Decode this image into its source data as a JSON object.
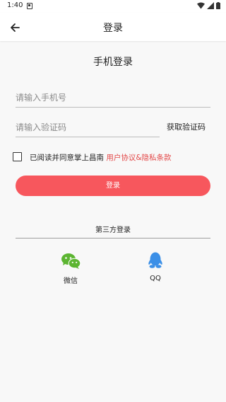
{
  "status_bar": {
    "time": "1:40"
  },
  "app_bar": {
    "title": "登录"
  },
  "page": {
    "heading": "手机登录"
  },
  "form": {
    "phone_placeholder": "请输入手机号",
    "code_placeholder": "请输入验证码",
    "get_code_label": "获取验证码",
    "agree_text": "已阅读并同意掌上昌南",
    "agree_link": "用户协议&隐私条款",
    "agree_checked": false,
    "login_label": "登录"
  },
  "third_party": {
    "title": "第三方登录",
    "items": [
      {
        "label": "微信",
        "icon": "wechat-icon"
      },
      {
        "label": "QQ",
        "icon": "qq-icon"
      }
    ]
  },
  "colors": {
    "accent": "#f7575d",
    "link": "#e34a4a",
    "wechat": "#5cb531",
    "qq": "#3b8fe7"
  }
}
